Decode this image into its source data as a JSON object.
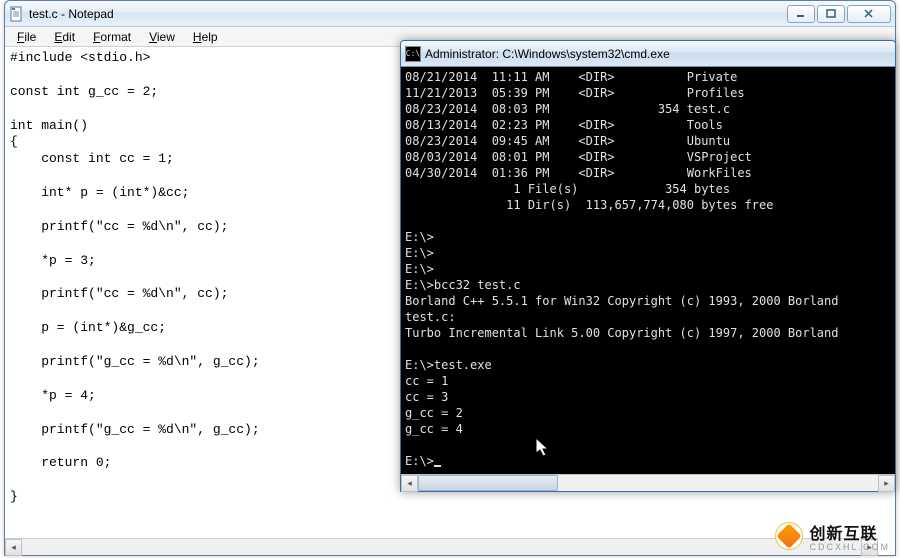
{
  "notepad": {
    "title": "test.c - Notepad",
    "menu": {
      "file": "File",
      "edit": "Edit",
      "format": "Format",
      "view": "View",
      "help": "Help"
    },
    "content": "#include <stdio.h>\n\nconst int g_cc = 2;\n\nint main()\n{\n    const int cc = 1;\n\n    int* p = (int*)&cc;\n\n    printf(\"cc = %d\\n\", cc);\n\n    *p = 3;\n\n    printf(\"cc = %d\\n\", cc);\n\n    p = (int*)&g_cc;\n\n    printf(\"g_cc = %d\\n\", g_cc);\n\n    *p = 4;\n\n    printf(\"g_cc = %d\\n\", g_cc);\n\n    return 0;\n\n}"
  },
  "cmd": {
    "title": "Administrator: C:\\Windows\\system32\\cmd.exe",
    "output": "08/21/2014  11:11 AM    <DIR>          Private\n11/21/2013  05:39 PM    <DIR>          Profiles\n08/23/2014  08:03 PM               354 test.c\n08/13/2014  02:23 PM    <DIR>          Tools\n08/23/2014  09:45 AM    <DIR>          Ubuntu\n08/03/2014  08:01 PM    <DIR>          VSProject\n04/30/2014  01:36 PM    <DIR>          WorkFiles\n               1 File(s)            354 bytes\n              11 Dir(s)  113,657,774,080 bytes free\n\nE:\\>\nE:\\>\nE:\\>\nE:\\>bcc32 test.c\nBorland C++ 5.5.1 for Win32 Copyright (c) 1993, 2000 Borland\ntest.c:\nTurbo Incremental Link 5.00 Copyright (c) 1997, 2000 Borland\n\nE:\\>test.exe\ncc = 1\ncc = 3\ng_cc = 2\ng_cc = 4\n\nE:\\>"
  },
  "watermark": {
    "text": "创新互联",
    "sub": "CDCXHL.COM"
  }
}
